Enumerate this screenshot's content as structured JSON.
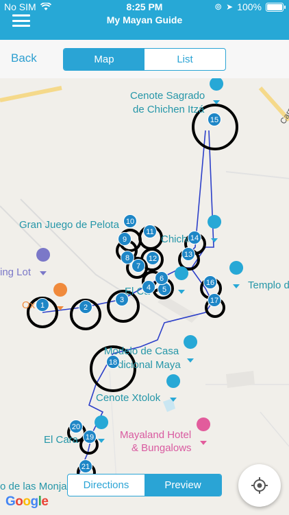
{
  "status": {
    "carrier": "No SIM",
    "time": "8:25 PM",
    "battery": "100%"
  },
  "nav": {
    "title": "My Mayan Guide"
  },
  "toolbar": {
    "back": "Back",
    "tab_map": "Map",
    "tab_list": "List"
  },
  "map_labels": {
    "cenote_sagrado": "Cenote Sagrado",
    "de_chichen_itza": "de Chichen Itzá",
    "juego_pelota": "Gran Juego de Pelota",
    "chichen": "Chichén",
    "parking": "ing Lot",
    "oxt": "Ox",
    "el_castillo": "El Ca",
    "templo": "Templo d",
    "modelo": "Modelo de Casa",
    "tradicional": "dicional Maya",
    "xtolok": "Cenote Xtolok",
    "el_caracol": "El Cara",
    "mayaland1": "Mayaland Hotel",
    "mayaland2": "& Bungalows",
    "monjas": "o de las Monja",
    "road": "Carr."
  },
  "markers": [
    "1",
    "2",
    "3",
    "4",
    "5",
    "6",
    "7",
    "8",
    "9",
    "10",
    "11",
    "12",
    "13",
    "14",
    "15",
    "16",
    "17",
    "18",
    "19",
    "20",
    "21"
  ],
  "bottom": {
    "directions": "Directions",
    "preview": "Preview"
  },
  "attribution": {
    "g1": "G",
    "g2": "o",
    "g3": "o",
    "g4": "g",
    "g5": "l",
    "g6": "e"
  },
  "colors": {
    "brand": "#27a8d6",
    "marker": "#1e86c6",
    "route": "#2c3fc9"
  }
}
